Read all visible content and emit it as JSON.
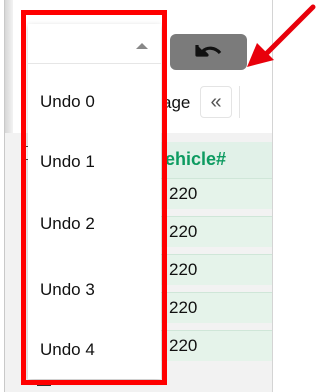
{
  "pager": {
    "label": "age",
    "first_page_glyph": "«"
  },
  "table": {
    "header": "ehicle#",
    "rows": [
      "220",
      "220",
      "220",
      "220",
      "220"
    ]
  },
  "undo_dropdown": {
    "selected_value": "",
    "options": [
      "Undo 0",
      "Undo 1",
      "Undo 2",
      "Undo 3",
      "Undo 4"
    ]
  },
  "undo_button": {
    "icon": "undo-icon"
  },
  "annotation": {
    "highlight_color": "#ff0000",
    "arrow_color": "#e8000b"
  },
  "colors": {
    "header_text": "#0d9b61",
    "row_bg": "#e5f3ea",
    "undo_button_bg": "#7b7b7b"
  }
}
